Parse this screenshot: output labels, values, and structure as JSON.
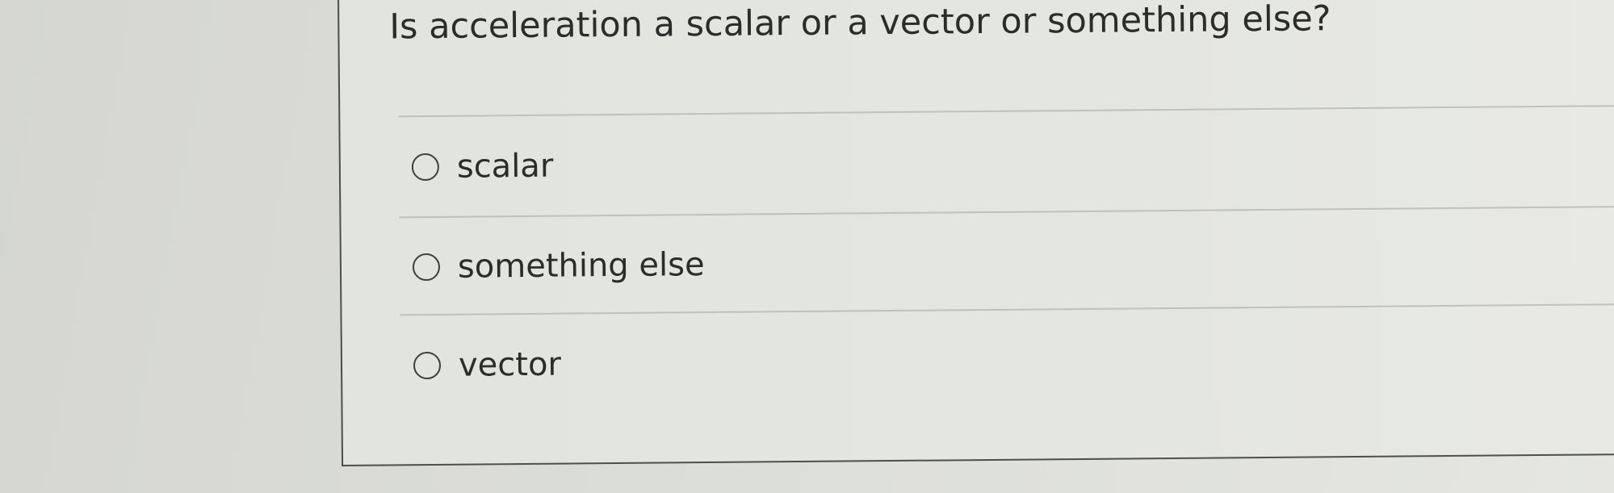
{
  "question": {
    "text": "Is acceleration a scalar or a vector or something else?"
  },
  "options": [
    {
      "label": "scalar",
      "selected": false
    },
    {
      "label": "something else",
      "selected": false
    },
    {
      "label": "vector",
      "selected": false
    }
  ]
}
